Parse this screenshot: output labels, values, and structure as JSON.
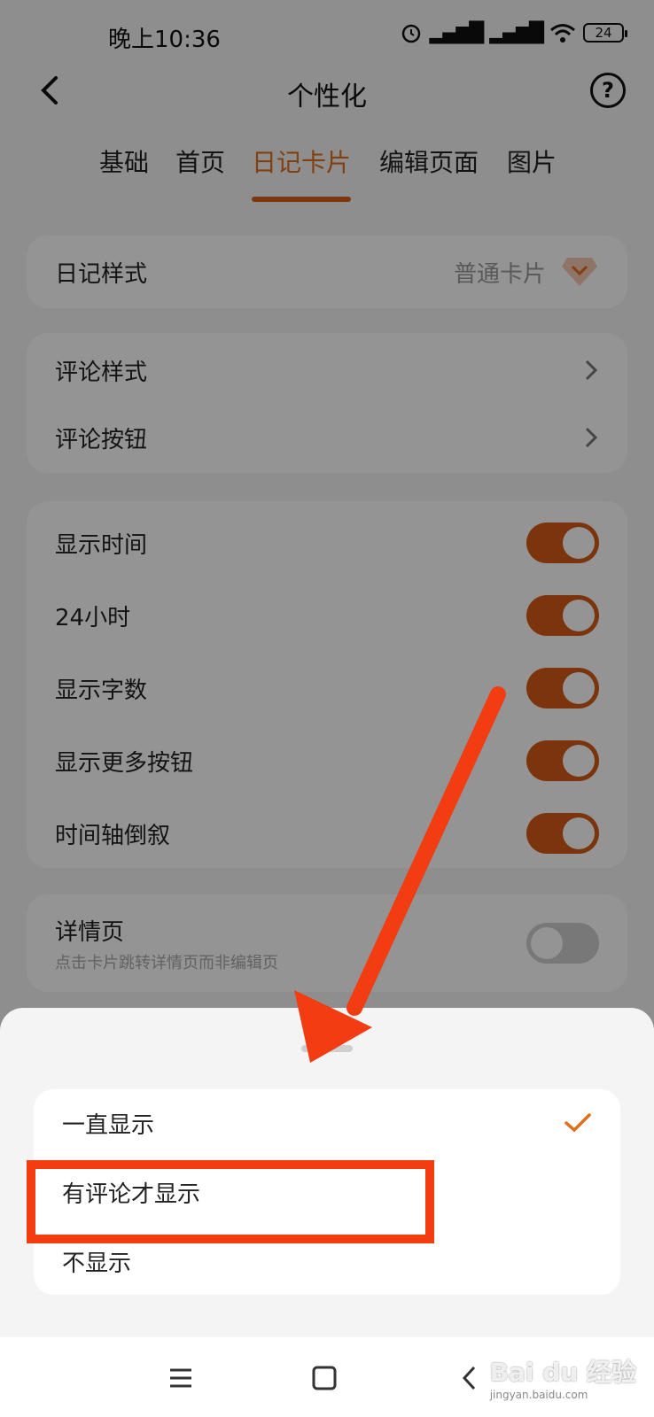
{
  "status_bar": {
    "time": "晚上10:36",
    "battery": "24"
  },
  "header": {
    "title": "个性化",
    "help": "?"
  },
  "tabs": [
    {
      "label": "基础"
    },
    {
      "label": "首页"
    },
    {
      "label": "日记卡片"
    },
    {
      "label": "编辑页面"
    },
    {
      "label": "图片"
    }
  ],
  "diary_style": {
    "label": "日记样式",
    "value": "普通卡片"
  },
  "comment_settings": [
    {
      "label": "评论样式"
    },
    {
      "label": "评论按钮"
    }
  ],
  "toggles": [
    {
      "label": "显示时间",
      "on": true
    },
    {
      "label": "24小时",
      "on": true
    },
    {
      "label": "显示字数",
      "on": true
    },
    {
      "label": "显示更多按钮",
      "on": true
    },
    {
      "label": "时间轴倒叙",
      "on": true
    }
  ],
  "detail_page": {
    "label": "详情页",
    "description": "点击卡片跳转详情页而非编辑页",
    "on": false
  },
  "sheet_options": [
    {
      "label": "一直显示",
      "selected": true
    },
    {
      "label": "有评论才显示",
      "selected": false
    },
    {
      "label": "不显示",
      "selected": false
    }
  ],
  "colors": {
    "accent": "#e06d1a",
    "annotation": "#f23c11"
  },
  "watermark": {
    "brand": "Bai du 经验",
    "site": "jingyan.baidu.com"
  }
}
